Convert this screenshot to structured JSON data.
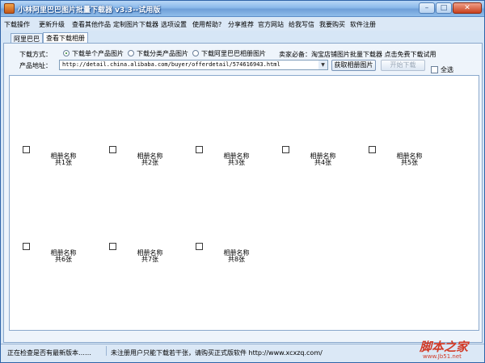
{
  "window": {
    "title": "小林阿里巴巴图片批量下载器 v3.3--试用版",
    "min_glyph": "–",
    "max_glyph": "□",
    "close_glyph": "✕"
  },
  "menu": {
    "items": [
      {
        "label": "下载操作"
      },
      {
        "label": "更新升级"
      },
      {
        "label": "查看其他作品"
      },
      {
        "label": "定制图片下载器"
      },
      {
        "label": "选项设置"
      },
      {
        "label": "使用帮助?"
      },
      {
        "label": "分享推荐"
      },
      {
        "label": "官方网站"
      },
      {
        "label": "给我写信"
      },
      {
        "label": "我要购买"
      },
      {
        "label": "软件注册"
      }
    ]
  },
  "tabs": [
    {
      "label": "阿里巴巴"
    },
    {
      "label": "查看下载相册"
    }
  ],
  "form": {
    "download_mode_label": "下载方式：",
    "mode_options": [
      {
        "label": "下载单个产品图片",
        "selected": true
      },
      {
        "label": "下载分类产品图片",
        "selected": false
      },
      {
        "label": "下载阿里巴巴相册图片",
        "selected": false
      }
    ],
    "promo_text": "卖家必备：淘宝店铺图片批量下载器 点击免费下载试用",
    "product_url_label": "产品地址：",
    "product_url_value": "http://detail.china.alibaba.com/buyer/offerdetail/574616943.html",
    "url_dropdown_glyph": "▼",
    "get_album_button": "获取相册图片",
    "start_download_button": "开始下载",
    "select_all_label": "全选"
  },
  "albums": [
    {
      "name": "相册名称",
      "count": "共1张"
    },
    {
      "name": "相册名称",
      "count": "共2张"
    },
    {
      "name": "相册名称",
      "count": "共3张"
    },
    {
      "name": "相册名称",
      "count": "共4张"
    },
    {
      "name": "相册名称",
      "count": "共5张"
    },
    {
      "name": "相册名称",
      "count": "共6张"
    },
    {
      "name": "相册名称",
      "count": "共7张"
    },
    {
      "name": "相册名称",
      "count": "共8张"
    }
  ],
  "status": {
    "left": "正在检查是否有最新版本……",
    "right": "未注册用户只能下载若干张，请购买正式版软件 http://www.xcxzq.com/"
  },
  "watermark": {
    "main": "脚本之家",
    "sub": "www.Jb51.net"
  },
  "colors": {
    "title_gradient": "#8bb9ea",
    "window_bg": "#d6e6f6",
    "watermark": "#d23a26"
  }
}
